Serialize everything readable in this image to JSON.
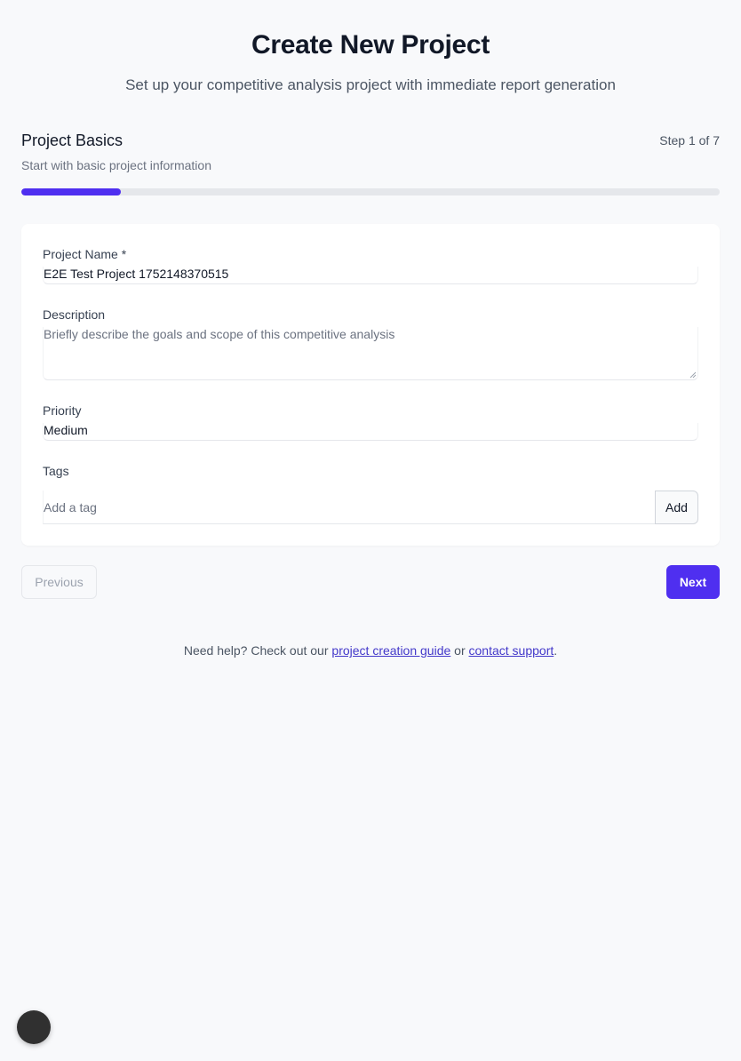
{
  "header": {
    "title": "Create New Project",
    "subtitle": "Set up your competitive analysis project with immediate report generation"
  },
  "step": {
    "title": "Project Basics",
    "counter": "Step 1 of 7",
    "description": "Start with basic project information",
    "progress_fraction": 0.143
  },
  "form": {
    "project_name": {
      "label": "Project Name *",
      "value": "E2E Test Project 1752148370515"
    },
    "description": {
      "label": "Description",
      "placeholder": "Briefly describe the goals and scope of this competitive analysis"
    },
    "priority": {
      "label": "Priority",
      "value": "Medium"
    },
    "tags": {
      "label": "Tags",
      "placeholder": "Add a tag",
      "add_label": "Add"
    }
  },
  "nav": {
    "previous_label": "Previous",
    "next_label": "Next"
  },
  "help": {
    "prefix": "Need help? Check out our ",
    "guide_link": "project creation guide",
    "middle": " or ",
    "support_link": "contact support",
    "suffix": "."
  },
  "colors": {
    "accent": "#4f2ff0",
    "progress_track": "#e5e7eb",
    "link": "#4338ca"
  }
}
